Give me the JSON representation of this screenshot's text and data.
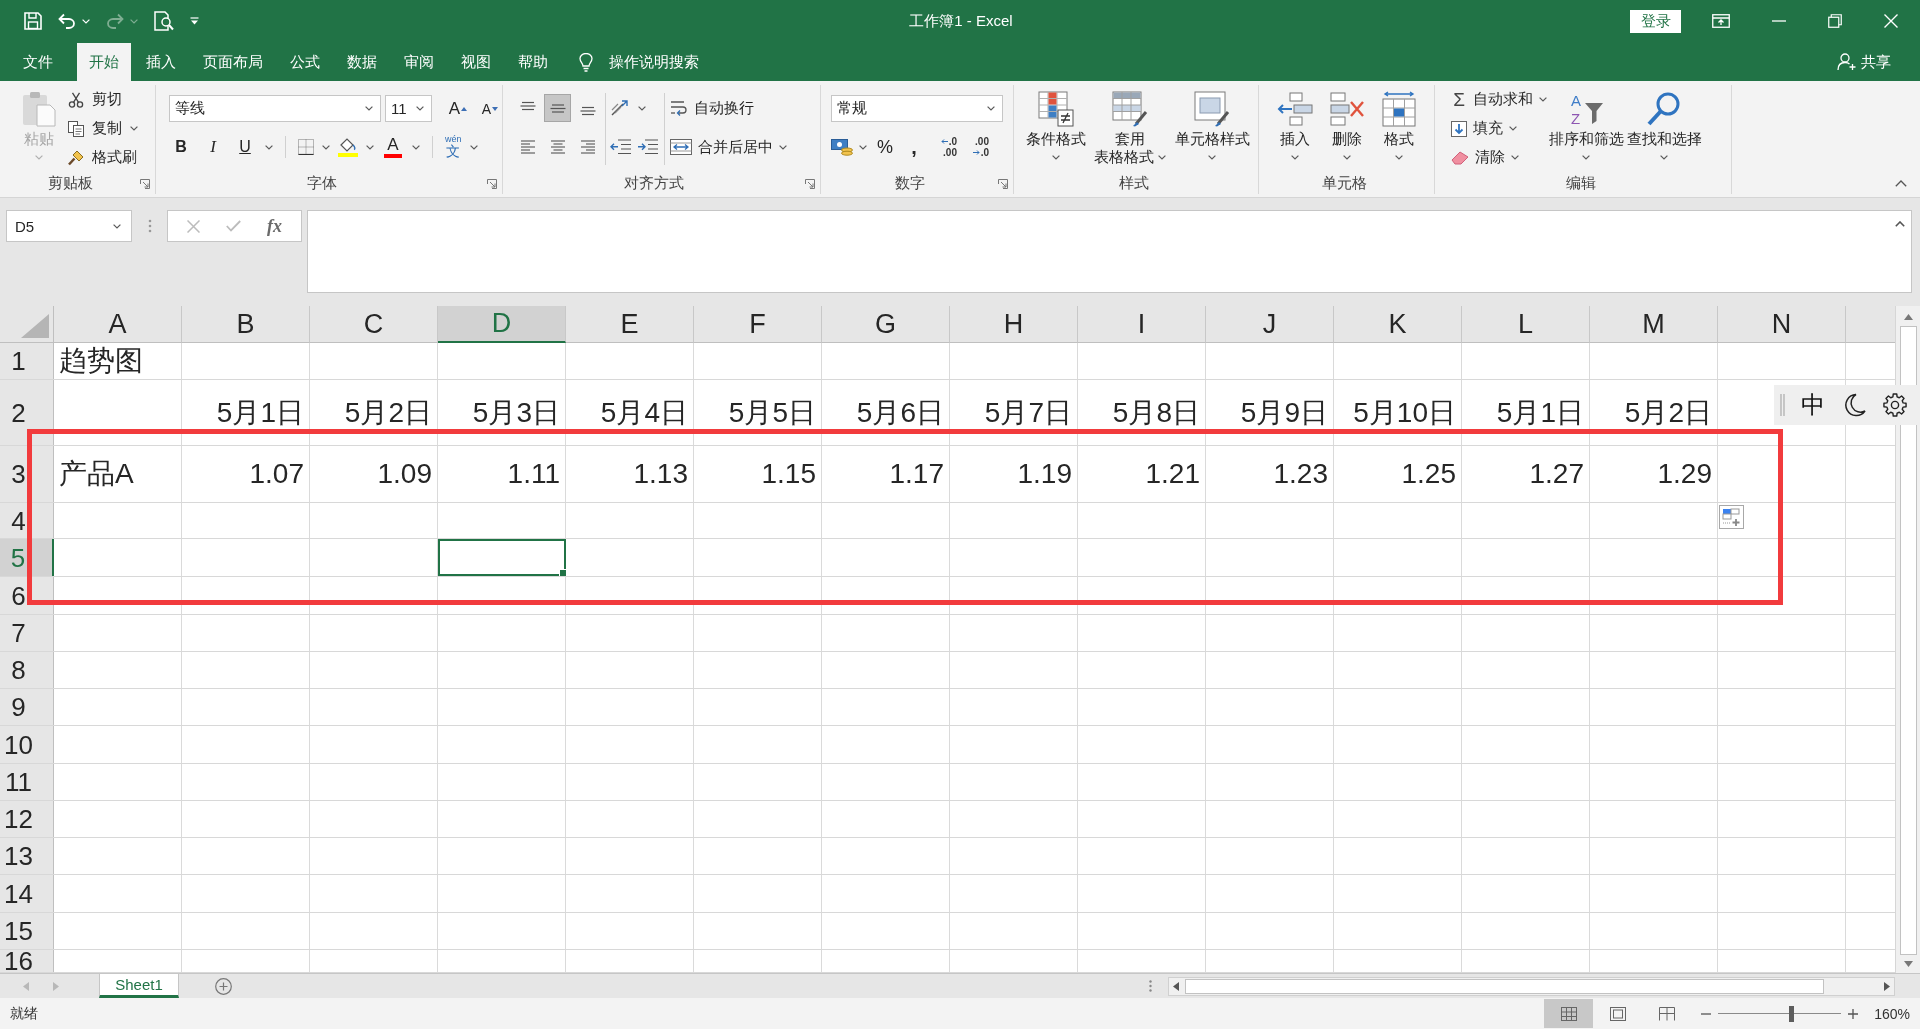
{
  "window": {
    "title": "工作簿1 - Excel",
    "sign_in": "登录"
  },
  "quick_access": [
    {
      "kind": "save",
      "disabled": false
    },
    {
      "kind": "undo",
      "disabled": false
    },
    {
      "kind": "redo",
      "disabled": true
    },
    {
      "kind": "print-preview",
      "disabled": false
    },
    {
      "kind": "customize",
      "disabled": false
    }
  ],
  "ribbon_tabs": [
    {
      "label": "文件",
      "selected": false
    },
    {
      "label": "开始",
      "selected": true
    },
    {
      "label": "插入",
      "selected": false
    },
    {
      "label": "页面布局",
      "selected": false
    },
    {
      "label": "公式",
      "selected": false
    },
    {
      "label": "数据",
      "selected": false
    },
    {
      "label": "审阅",
      "selected": false
    },
    {
      "label": "视图",
      "selected": false
    },
    {
      "label": "帮助",
      "selected": false
    }
  ],
  "tell_me": "操作说明搜索",
  "share": "共享",
  "ribbon_groups": [
    {
      "kind": "clipboard",
      "title": "剪贴板",
      "paste": {
        "label": "粘贴",
        "disabled": true
      },
      "buttons": [
        {
          "kind": "cut",
          "label": "剪切"
        },
        {
          "kind": "copy",
          "label": "复制"
        },
        {
          "kind": "format-painter",
          "label": "格式刷"
        }
      ]
    },
    {
      "kind": "font",
      "title": "字体",
      "font_name": "等线",
      "font_size": "11",
      "grow": "A",
      "shrink": "A",
      "bold": "B",
      "italic": "I",
      "underline": "U",
      "font_color": "A",
      "phonetic": {
        "pinyin": "wén",
        "character": "文"
      }
    },
    {
      "kind": "alignment",
      "title": "对齐方式",
      "vertical": [
        {
          "selected": false
        },
        {
          "selected": true
        },
        {
          "selected": false
        }
      ],
      "horizontal": [
        {
          "selected": false
        },
        {
          "selected": false
        },
        {
          "selected": false
        }
      ],
      "wrap_text": "自动换行",
      "merge": "合并后居中"
    },
    {
      "kind": "number",
      "title": "数字",
      "format": "常规",
      "percent": "%",
      "comma": ",",
      "increase_decimal": [
        ".0",
        ".00"
      ],
      "decrease_decimal": [
        ".00",
        ".0"
      ]
    },
    {
      "kind": "styles",
      "title": "样式",
      "buttons": [
        {
          "kind": "conditional",
          "lines": [
            "条件格式"
          ]
        },
        {
          "kind": "table",
          "lines": [
            "套用",
            "表格格式"
          ]
        },
        {
          "kind": "cell-styles",
          "lines": [
            "单元格样式"
          ]
        }
      ]
    },
    {
      "kind": "cells",
      "title": "单元格",
      "buttons": [
        {
          "kind": "insert",
          "label": "插入"
        },
        {
          "kind": "delete",
          "label": "删除"
        },
        {
          "kind": "format",
          "label": "格式"
        }
      ]
    },
    {
      "kind": "editing",
      "title": "编辑",
      "buttons": [
        {
          "kind": "autosum",
          "symbol": "Σ",
          "label": "自动求和"
        },
        {
          "kind": "fill",
          "label": "填充"
        },
        {
          "kind": "clear",
          "label": "清除"
        }
      ],
      "sort": {
        "letters": [
          "A",
          "Z"
        ],
        "label": "排序和筛选"
      },
      "find": "查找和选择"
    }
  ],
  "formula_bar": {
    "name_box": "D5",
    "function_button": "fx"
  },
  "sheet": {
    "columns": [
      {
        "label": "A",
        "selected": false
      },
      {
        "label": "B",
        "selected": false
      },
      {
        "label": "C",
        "selected": false
      },
      {
        "label": "D",
        "selected": true
      },
      {
        "label": "E",
        "selected": false
      },
      {
        "label": "F",
        "selected": false
      },
      {
        "label": "G",
        "selected": false
      },
      {
        "label": "H",
        "selected": false
      },
      {
        "label": "I",
        "selected": false
      },
      {
        "label": "J",
        "selected": false
      },
      {
        "label": "K",
        "selected": false
      },
      {
        "label": "L",
        "selected": false
      },
      {
        "label": "M",
        "selected": false
      },
      {
        "label": "N",
        "selected": false
      }
    ],
    "rows": [
      {
        "label": "1",
        "selected": false,
        "cells": [
          {
            "text": "趋势图",
            "kind": "text"
          }
        ]
      },
      {
        "label": "2",
        "selected": false,
        "cells": [
          null,
          {
            "text": "5月1日",
            "kind": "date"
          },
          {
            "text": "5月2日",
            "kind": "date"
          },
          {
            "text": "5月3日",
            "kind": "date"
          },
          {
            "text": "5月4日",
            "kind": "date"
          },
          {
            "text": "5月5日",
            "kind": "date"
          },
          {
            "text": "5月6日",
            "kind": "date"
          },
          {
            "text": "5月7日",
            "kind": "date"
          },
          {
            "text": "5月8日",
            "kind": "date"
          },
          {
            "text": "5月9日",
            "kind": "date"
          },
          {
            "text": "5月10日",
            "kind": "date"
          },
          {
            "text": "5月1日",
            "kind": "date"
          },
          {
            "text": "5月2日",
            "kind": "date"
          }
        ]
      },
      {
        "label": "3",
        "selected": false,
        "cells": [
          {
            "text": "产品A",
            "kind": "text"
          },
          {
            "text": "1.07",
            "kind": "number"
          },
          {
            "text": "1.09",
            "kind": "number"
          },
          {
            "text": "1.11",
            "kind": "number"
          },
          {
            "text": "1.13",
            "kind": "number"
          },
          {
            "text": "1.15",
            "kind": "number"
          },
          {
            "text": "1.17",
            "kind": "number"
          },
          {
            "text": "1.19",
            "kind": "number"
          },
          {
            "text": "1.21",
            "kind": "number"
          },
          {
            "text": "1.23",
            "kind": "number"
          },
          {
            "text": "1.25",
            "kind": "number"
          },
          {
            "text": "1.27",
            "kind": "number"
          },
          {
            "text": "1.29",
            "kind": "number"
          }
        ]
      },
      {
        "label": "4",
        "selected": false
      },
      {
        "label": "5",
        "selected": true
      },
      {
        "label": "6",
        "selected": false
      },
      {
        "label": "7",
        "selected": false
      },
      {
        "label": "8",
        "selected": false
      },
      {
        "label": "9",
        "selected": false
      },
      {
        "label": "10",
        "selected": false
      },
      {
        "label": "11",
        "selected": false
      },
      {
        "label": "12",
        "selected": false
      },
      {
        "label": "13",
        "selected": false
      },
      {
        "label": "14",
        "selected": false
      },
      {
        "label": "15",
        "selected": false
      },
      {
        "label": "16",
        "selected": false
      }
    ],
    "quick_analysis": true,
    "highlight": {
      "kind": "rectangle"
    }
  },
  "ime_bar": {
    "mode": "中"
  },
  "sheet_tabs": [
    {
      "label": "Sheet1",
      "selected": true
    }
  ],
  "status_bar": {
    "status": "就绪",
    "views": [
      {
        "kind": "normal",
        "selected": true
      },
      {
        "kind": "page-layout",
        "selected": false
      },
      {
        "kind": "page-break-preview",
        "selected": false
      }
    ],
    "zoom": {
      "level": 0.6,
      "reading": "160%"
    }
  }
}
